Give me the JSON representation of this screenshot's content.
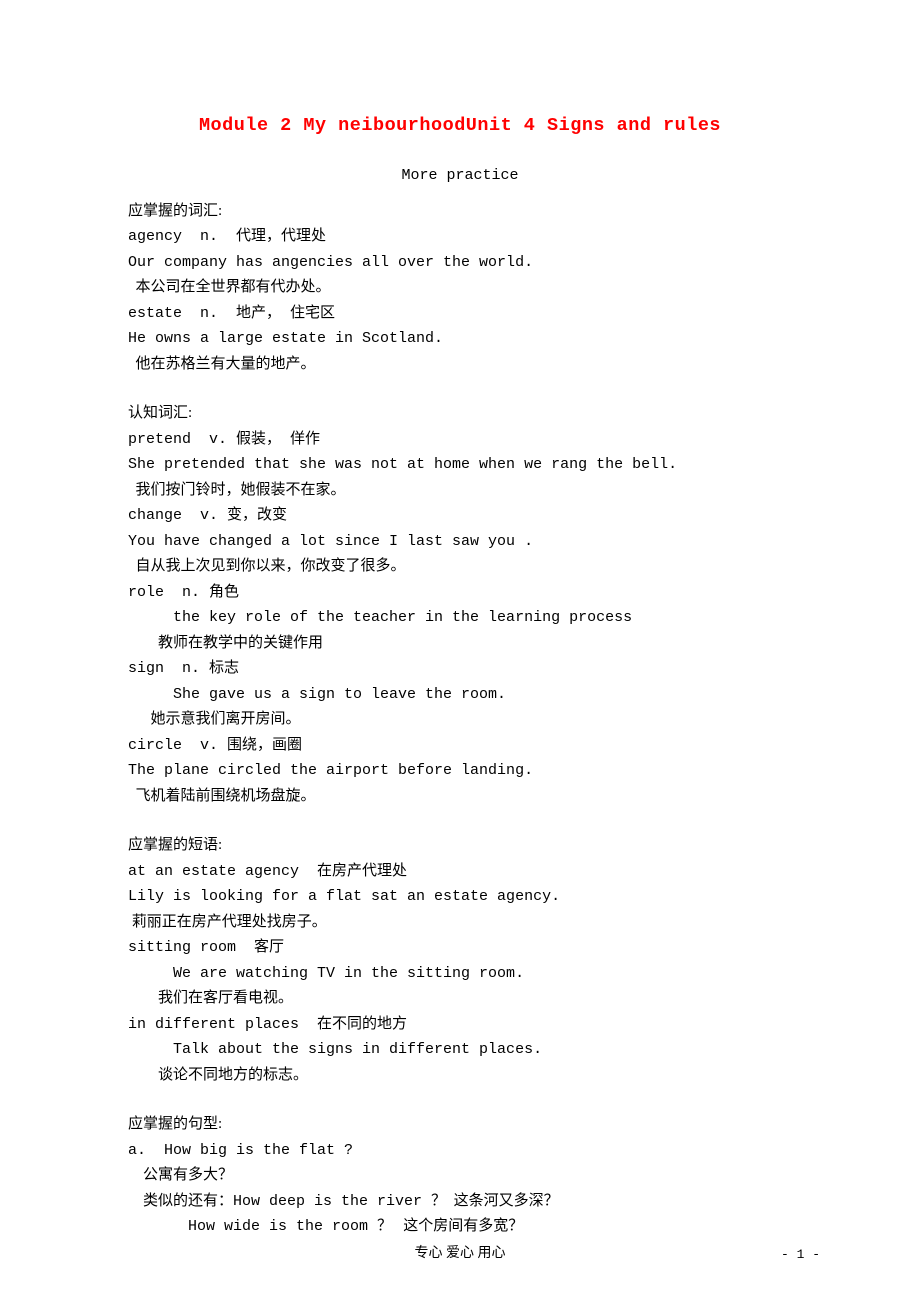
{
  "title": "Module 2 My neibourhoodUnit 4 Signs and rules",
  "subtitle": "More practice",
  "section1": {
    "heading": "应掌握的词汇:",
    "items": [
      {
        "term": "agency  n.  代理，代理处",
        "ex_en": "Our company has angencies all over the world.",
        "ex_zh": "  本公司在全世界都有代办处。"
      },
      {
        "term": "estate  n.  地产， 住宅区",
        "ex_en": "He owns a large estate in Scotland.",
        "ex_zh": "  他在苏格兰有大量的地产。"
      }
    ]
  },
  "section2": {
    "heading": "认知词汇:",
    "items": [
      {
        "term": "pretend  v. 假装， 佯作",
        "ex_en": "She pretended that she was not at home when we rang the bell.",
        "ex_zh": "  我们按门铃时，她假装不在家。"
      },
      {
        "term": "change  v. 变，改变",
        "ex_en": "You have changed a lot since I last saw you .",
        "ex_zh": "  自从我上次见到你以来，你改变了很多。"
      },
      {
        "term": "role  n. 角色",
        "ex_en": "     the key role of the teacher in the learning process",
        "ex_zh": "        教师在教学中的关键作用"
      },
      {
        "term": "sign  n. 标志",
        "ex_en": "     She gave us a sign to leave the room.",
        "ex_zh": "      她示意我们离开房间。"
      },
      {
        "term": "circle  v. 围绕，画圈",
        "ex_en": "The plane circled the airport before landing.",
        "ex_zh": "  飞机着陆前围绕机场盘旋。"
      }
    ]
  },
  "section3": {
    "heading": "应掌握的短语:",
    "items": [
      {
        "term": "at an estate agency  在房产代理处",
        "ex_en": "Lily is looking for a flat sat an estate agency.",
        "ex_zh": " 莉丽正在房产代理处找房子。"
      },
      {
        "term": "sitting room  客厅",
        "ex_en": "     We are watching TV in the sitting room.",
        "ex_zh": "        我们在客厅看电视。"
      },
      {
        "term": "in different places  在不同的地方",
        "ex_en": "     Talk about the signs in different places.",
        "ex_zh": "        谈论不同地方的标志。"
      }
    ]
  },
  "section4": {
    "heading": "应掌握的句型:",
    "a_q": "a.  How big is the flat ?",
    "a_zh": "    公寓有多大？",
    "a_sim_intro": "    类似的还有：",
    "a_sim1_en": "How deep is the river ？",
    "a_sim1_zh": "  这条河又多深？",
    "a_sim2_pad": "                ",
    "a_sim2_en": "How wide is the room ？",
    "a_sim2_zh": "   这个房间有多宽？"
  },
  "footer": "专心    爱心    用心",
  "pagenum": "- 1 -"
}
